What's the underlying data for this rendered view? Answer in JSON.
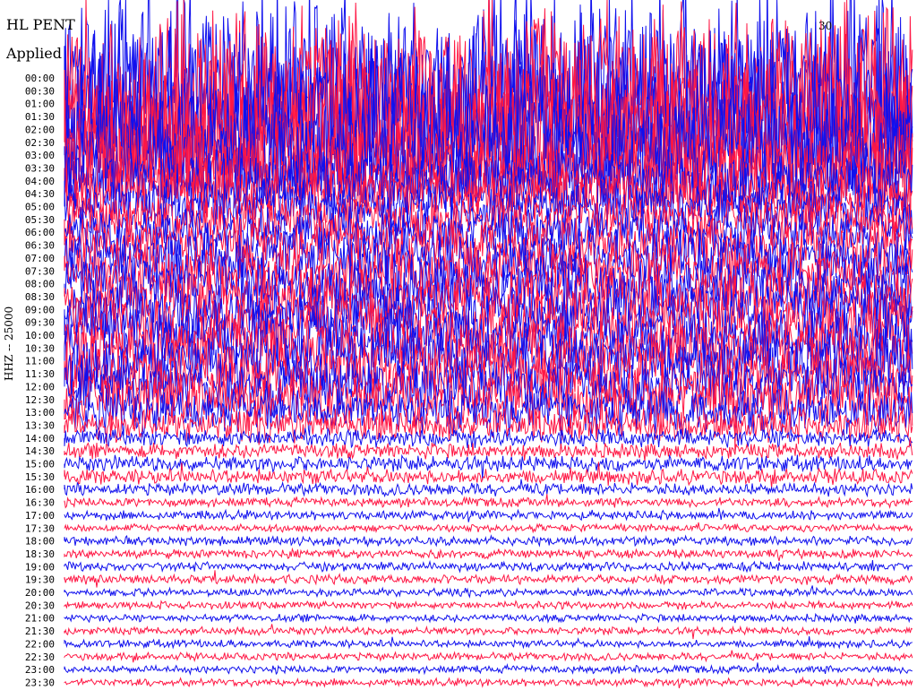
{
  "header": {
    "title": "HL PENT",
    "subtitle": "Applied",
    "corner_text": "30"
  },
  "chart_data": {
    "type": "line",
    "title": "HL PENT",
    "ylabel": "HHZ -- 25000",
    "row_labels": [
      "00:00",
      "00:30",
      "01:00",
      "01:30",
      "02:00",
      "02:30",
      "03:00",
      "03:30",
      "04:00",
      "04:30",
      "05:00",
      "05:30",
      "06:00",
      "06:30",
      "07:00",
      "07:30",
      "08:00",
      "08:30",
      "09:00",
      "09:30",
      "10:00",
      "10:30",
      "11:00",
      "11:30",
      "12:00",
      "12:30",
      "13:00",
      "13:30",
      "14:00",
      "14:30",
      "15:00",
      "15:30",
      "16:00",
      "16:30",
      "17:00",
      "17:30",
      "18:00",
      "18:30",
      "19:00",
      "19:30",
      "20:00",
      "20:30",
      "21:00",
      "21:30",
      "22:00",
      "22:30",
      "23:00",
      "23:30"
    ],
    "series_colors": [
      "#1010ee",
      "#ff1744"
    ],
    "row_amplitude": [
      120,
      115,
      110,
      105,
      100,
      95,
      80,
      55,
      45,
      40,
      35,
      33,
      32,
      36,
      40,
      40,
      40,
      40,
      42,
      42,
      45,
      45,
      45,
      42,
      40,
      38,
      30,
      22,
      12,
      10,
      10,
      10,
      8,
      6,
      6,
      5,
      6,
      6,
      6,
      6,
      5,
      5,
      5,
      5,
      5,
      5,
      5,
      5
    ]
  }
}
